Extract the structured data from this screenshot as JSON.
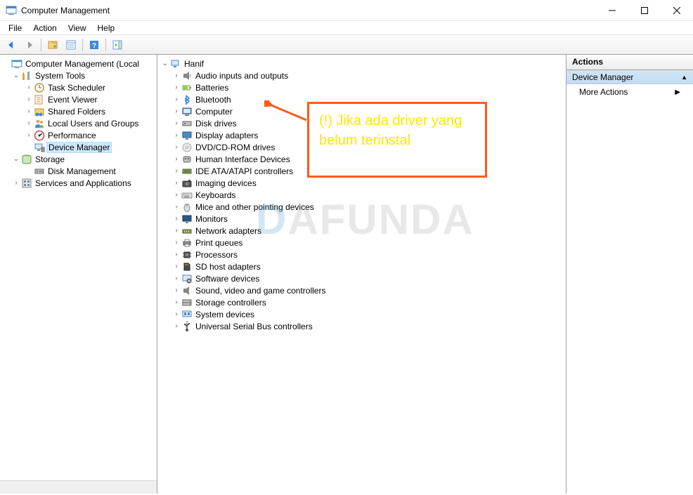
{
  "window": {
    "title": "Computer Management"
  },
  "menu": {
    "file": "File",
    "action": "Action",
    "view": "View",
    "help": "Help"
  },
  "tree": {
    "root": "Computer Management (Local",
    "systemTools": "System Tools",
    "taskScheduler": "Task Scheduler",
    "eventViewer": "Event Viewer",
    "sharedFolders": "Shared Folders",
    "localUsers": "Local Users and Groups",
    "performance": "Performance",
    "deviceManager": "Device Manager",
    "storage": "Storage",
    "diskManagement": "Disk Management",
    "servicesApps": "Services and Applications"
  },
  "devices": {
    "root": "Hanif",
    "items": [
      "Audio inputs and outputs",
      "Batteries",
      "Bluetooth",
      "Computer",
      "Disk drives",
      "Display adapters",
      "DVD/CD-ROM drives",
      "Human Interface Devices",
      "IDE ATA/ATAPI controllers",
      "Imaging devices",
      "Keyboards",
      "Mice and other pointing devices",
      "Monitors",
      "Network adapters",
      "Print queues",
      "Processors",
      "SD host adapters",
      "Software devices",
      "Sound, video and game controllers",
      "Storage controllers",
      "System devices",
      "Universal Serial Bus controllers"
    ]
  },
  "actions": {
    "header": "Actions",
    "section": "Device Manager",
    "more": "More Actions"
  },
  "annotation": {
    "text": "(!) Jika ada driver yang belum terinstal"
  },
  "watermark": {
    "prefix": "D",
    "suffix": "AFUNDA"
  }
}
